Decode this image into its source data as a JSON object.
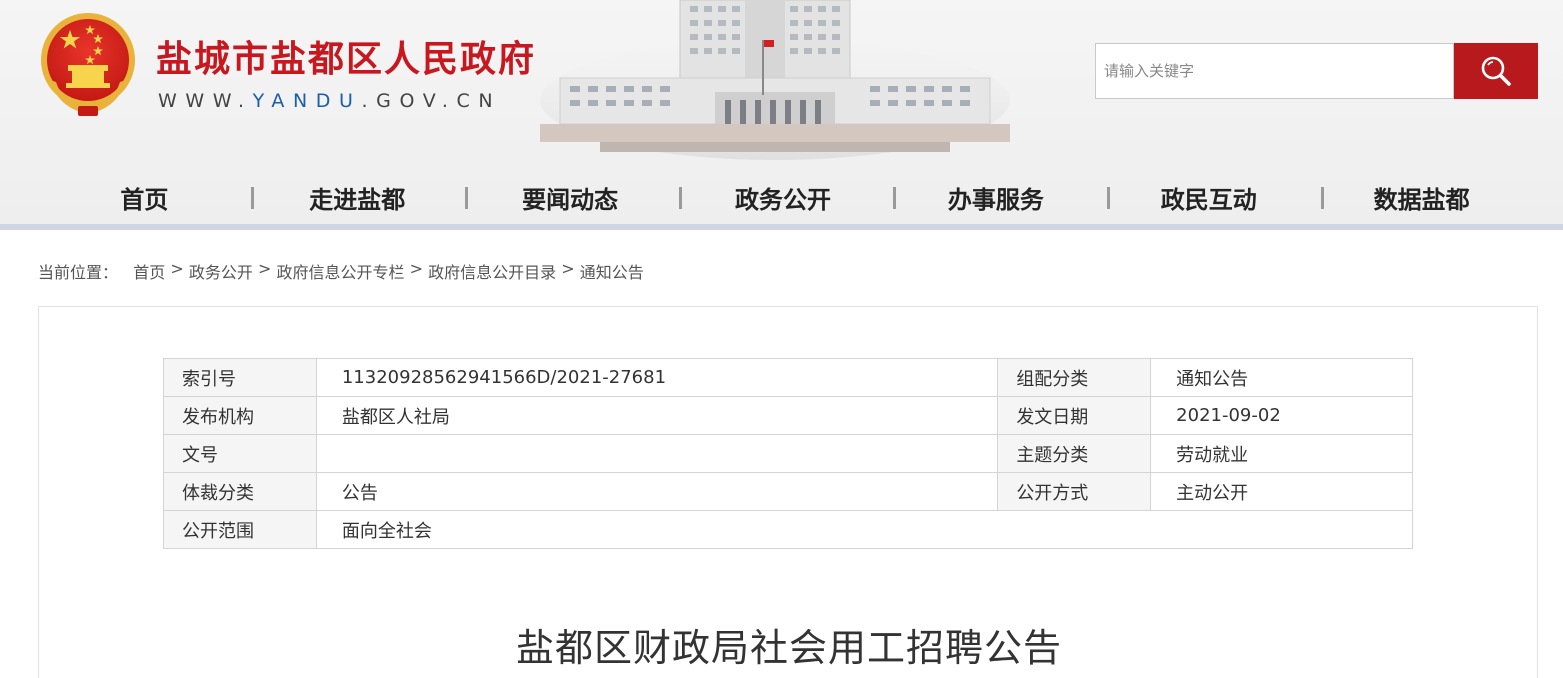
{
  "header": {
    "site_title": "盐城市盐都区人民政府",
    "url_prefix": "WWW.",
    "url_highlight": "YANDU",
    "url_suffix": ".GOV.CN",
    "search_placeholder": "请输入关键字",
    "brand_color": "#c8171e",
    "search_button_color": "#b7191d"
  },
  "nav": {
    "items": [
      {
        "label": "首页"
      },
      {
        "label": "走进盐都"
      },
      {
        "label": "要闻动态"
      },
      {
        "label": "政务公开"
      },
      {
        "label": "办事服务"
      },
      {
        "label": "政民互动"
      },
      {
        "label": "数据盐都"
      }
    ]
  },
  "breadcrumb": {
    "prefix": "当前位置：",
    "items": [
      "首页",
      "政务公开",
      "政府信息公开专栏",
      "政府信息公开目录",
      "通知公告"
    ],
    "separator": ">"
  },
  "info_table": {
    "rows": [
      {
        "label1": "索引号",
        "value1": "1132092856294156​6D/2021-27681",
        "label2": "组配分类",
        "value2": "通知公告"
      },
      {
        "label1": "发布机构",
        "value1": "盐都区人社局",
        "label2": "发文日期",
        "value2": "2021-09-02"
      },
      {
        "label1": "文号",
        "value1": "",
        "label2": "主题分类",
        "value2": "劳动就业"
      },
      {
        "label1": "体裁分类",
        "value1": "公告",
        "label2": "公开方式",
        "value2": "主动公开"
      },
      {
        "label1": "公开范围",
        "value1": "面向全社会",
        "label2": "",
        "value2": ""
      }
    ]
  },
  "article": {
    "title": "盐都区财政局社会用工招聘公告"
  }
}
